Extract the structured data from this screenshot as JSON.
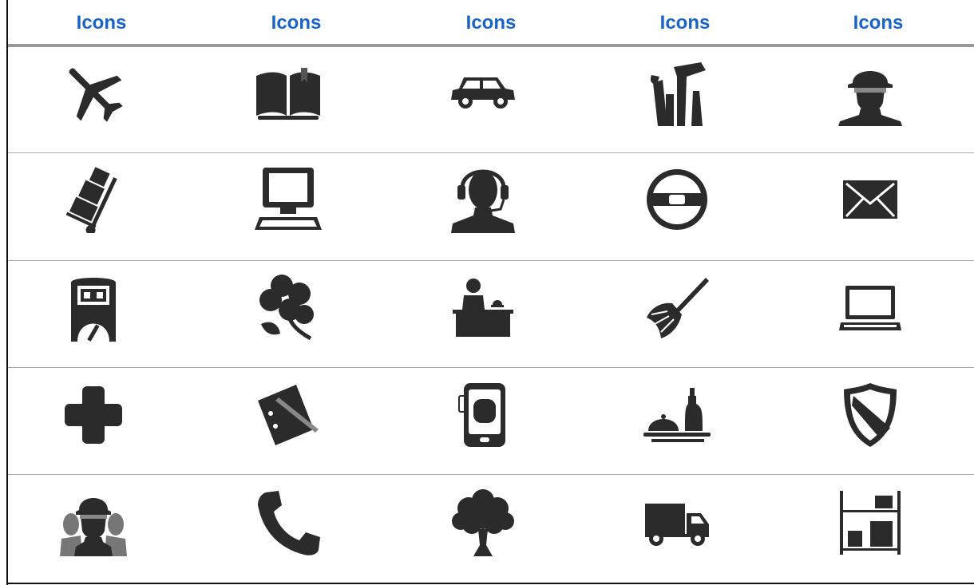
{
  "header": {
    "columns": [
      "Icons",
      "Icons",
      "Icons",
      "Icons",
      "Icons"
    ]
  },
  "colors": {
    "header_text": "#1a63c6",
    "icon": "#2b2b2b",
    "rule": "#aaaaaa"
  },
  "grid": {
    "rows": [
      [
        "airplane-icon",
        "open-book-icon",
        "car-icon",
        "tools-icon",
        "construction-worker-icon"
      ],
      [
        "hand-truck-icon",
        "desktop-computer-icon",
        "headset-operator-icon",
        "steering-wheel-icon",
        "envelope-icon"
      ],
      [
        "utility-meter-icon",
        "clover-icon",
        "receptionist-icon",
        "feather-duster-icon",
        "laptop-icon"
      ],
      [
        "medical-cross-icon",
        "notepad-pen-icon",
        "tablet-icon",
        "room-service-icon",
        "shield-icon"
      ],
      [
        "workers-group-icon",
        "phone-handset-icon",
        "tree-icon",
        "truck-icon",
        "shelving-boxes-icon"
      ]
    ]
  }
}
